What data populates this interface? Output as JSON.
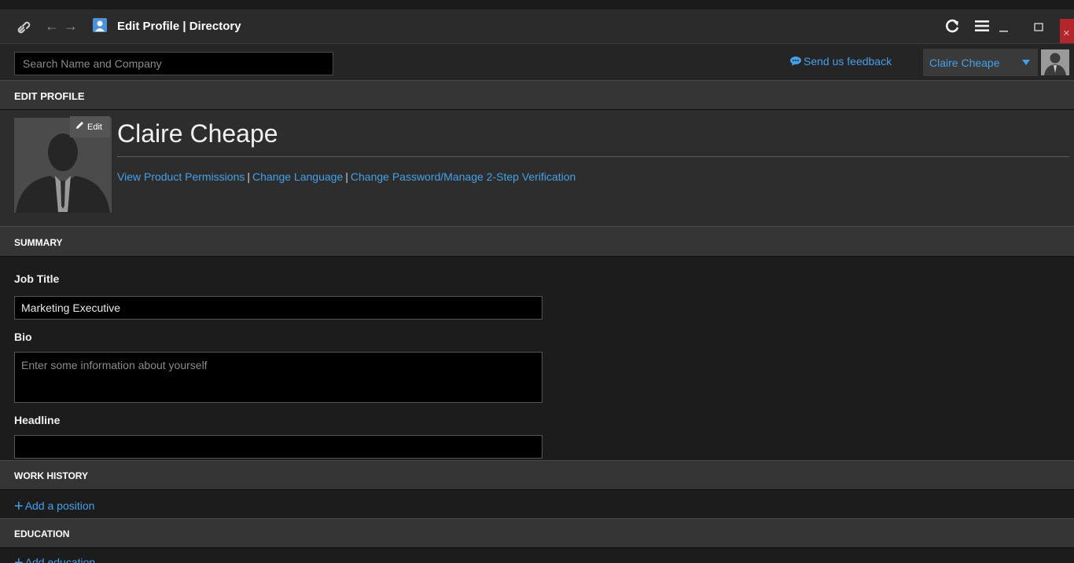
{
  "window": {
    "title": "Edit Profile | Directory",
    "icons": [
      "link-icon",
      "back-arrow-icon",
      "forward-arrow-icon",
      "app-person-icon",
      "refresh-icon",
      "hamburger-menu-icon",
      "minimize-icon",
      "maximize-icon",
      "close-icon"
    ],
    "nav_back": "←",
    "nav_forward": "→",
    "close_glyph": "×"
  },
  "header": {
    "search_placeholder": "Search Name and Company",
    "feedback_label": "Send us feedback",
    "user_name": "Claire Cheape"
  },
  "edit_profile": {
    "section_title": "EDIT PROFILE",
    "edit_label": "Edit",
    "name": "Claire Cheape",
    "links": [
      "View Product Permissions",
      "Change Language",
      "Change Password/Manage 2-Step Verification"
    ],
    "link_separator": "|"
  },
  "summary": {
    "section_title": "SUMMARY",
    "job_title_label": "Job Title",
    "job_title_value": "Marketing Executive",
    "bio_label": "Bio",
    "bio_placeholder": "Enter some information about yourself",
    "headline_label": "Headline",
    "headline_value": ""
  },
  "work_history": {
    "section_title": "WORK HISTORY",
    "add_label": "Add a position"
  },
  "education": {
    "section_title": "EDUCATION",
    "add_label": "Add education"
  },
  "colors": {
    "accent_link": "#42a1e8",
    "close_button": "#b2262c",
    "section_header": "#353535",
    "background": "#1b1b1b"
  }
}
